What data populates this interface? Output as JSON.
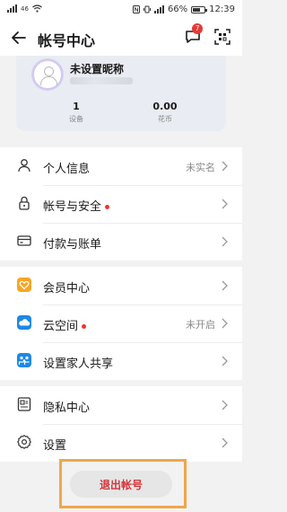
{
  "status_bar": {
    "network": "46",
    "battery_percent": "66%",
    "battery_level": 0.66,
    "time": "12:39"
  },
  "header": {
    "title": "帐号中心",
    "message_badge": "7",
    "back_icon": "arrow-left-icon",
    "message_icon": "chat-bubble-icon",
    "scan_icon": "scan-icon"
  },
  "profile": {
    "nickname": "未设置昵称",
    "stats": [
      {
        "value": "1",
        "label": "设备"
      },
      {
        "value": "0.00",
        "label": "花币"
      }
    ]
  },
  "menu_groups": [
    {
      "items": [
        {
          "label": "个人信息",
          "value": "未实名",
          "icon": "person-icon",
          "dot": false
        },
        {
          "label": "帐号与安全",
          "value": "",
          "icon": "lock-icon",
          "dot": true
        },
        {
          "label": "付款与账单",
          "value": "",
          "icon": "card-icon",
          "dot": false
        }
      ]
    },
    {
      "items": [
        {
          "label": "会员中心",
          "value": "",
          "icon": "member-icon",
          "dot": false
        },
        {
          "label": "云空间",
          "value": "未开启",
          "icon": "cloud-icon",
          "dot": true
        },
        {
          "label": "设置家人共享",
          "value": "",
          "icon": "family-share-icon",
          "dot": false
        }
      ]
    },
    {
      "items": [
        {
          "label": "隐私中心",
          "value": "",
          "icon": "privacy-icon",
          "dot": false
        },
        {
          "label": "设置",
          "value": "",
          "icon": "gear-icon",
          "dot": false
        }
      ]
    }
  ],
  "logout_label": "退出帐号",
  "colors": {
    "accent_red": "#d3343a",
    "highlight_orange": "#f0a64a",
    "member_orange": "#f5a623",
    "cloud_blue": "#1e88e5"
  }
}
